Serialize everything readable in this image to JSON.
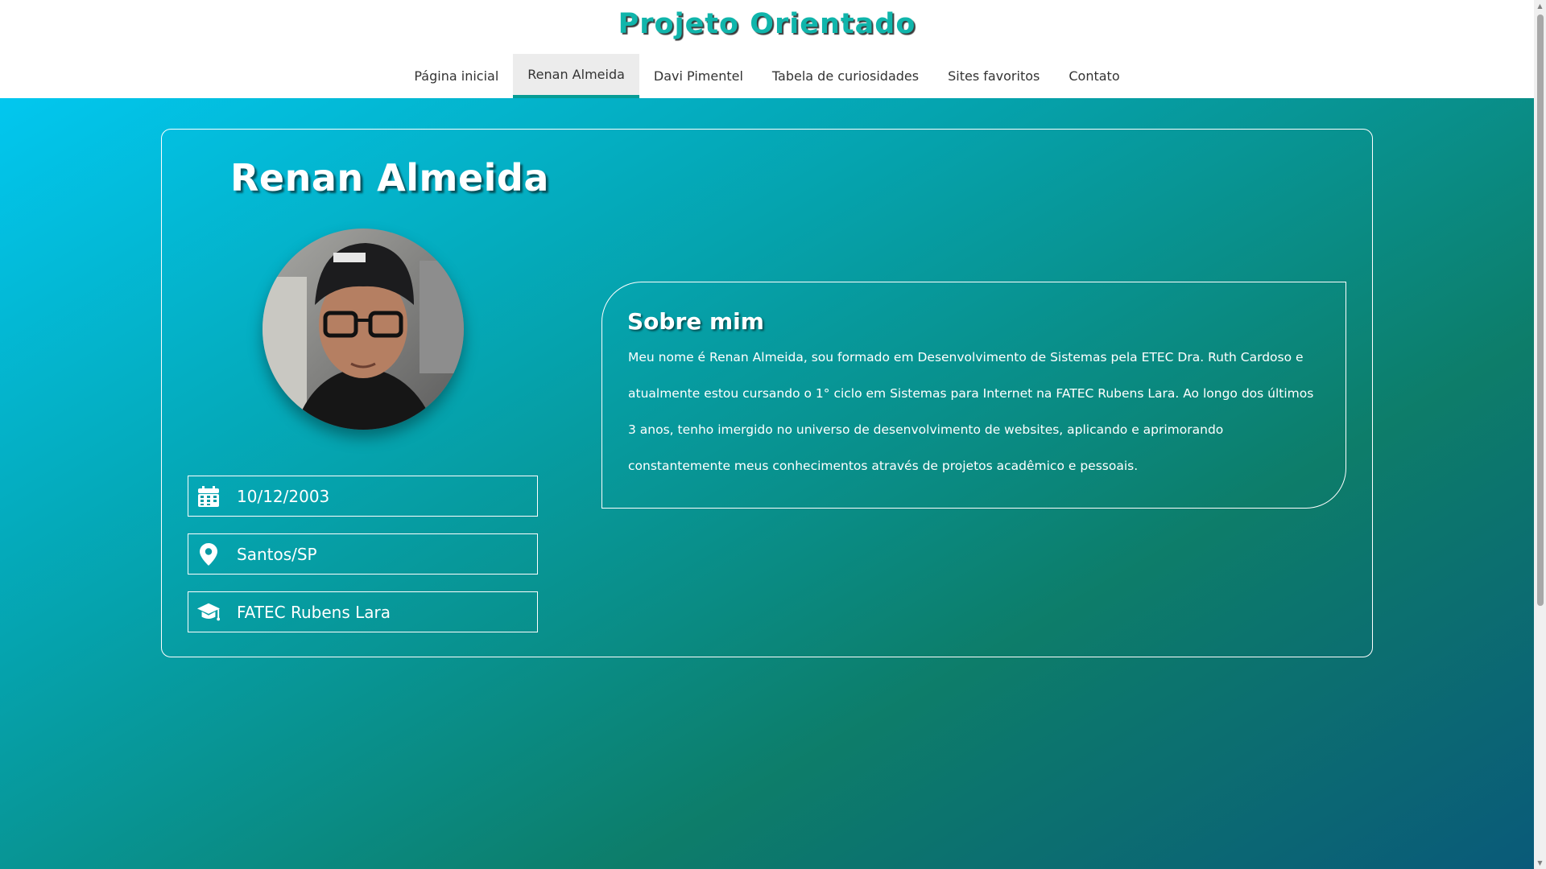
{
  "site": {
    "title": "Projeto Orientado"
  },
  "nav": {
    "items": [
      {
        "label": "Página inicial",
        "active": false
      },
      {
        "label": "Renan Almeida",
        "active": true
      },
      {
        "label": "Davi Pimentel",
        "active": false
      },
      {
        "label": "Tabela de curiosidades",
        "active": false
      },
      {
        "label": "Sites favoritos",
        "active": false
      },
      {
        "label": "Contato",
        "active": false
      }
    ],
    "active_color": "#079c95"
  },
  "profile": {
    "name": "Renan Almeida",
    "avatar_icon": "profile-photo",
    "info": [
      {
        "icon": "calendar-icon",
        "text": "10/12/2003"
      },
      {
        "icon": "map-pin-icon",
        "text": "Santos/SP"
      },
      {
        "icon": "graduation-cap-icon",
        "text": "FATEC Rubens Lara"
      }
    ]
  },
  "about": {
    "title": "Sobre mim",
    "text": "Meu nome é Renan Almeida, sou formado em Desenvolvimento de Sistemas pela ETEC Dra. Ruth Cardoso e atualmente estou cursando o 1° ciclo em Sistemas para Internet na FATEC Rubens Lara. Ao longo dos últimos 3 anos, tenho imergido no universo de desenvolvimento de websites, aplicando e aprimorando constantemente meus conhecimentos através de projetos acadêmico e pessoais."
  },
  "colors": {
    "title": "#10b5ab",
    "gradient_start": "#02c7ef",
    "gradient_end": "#0a5a79"
  }
}
